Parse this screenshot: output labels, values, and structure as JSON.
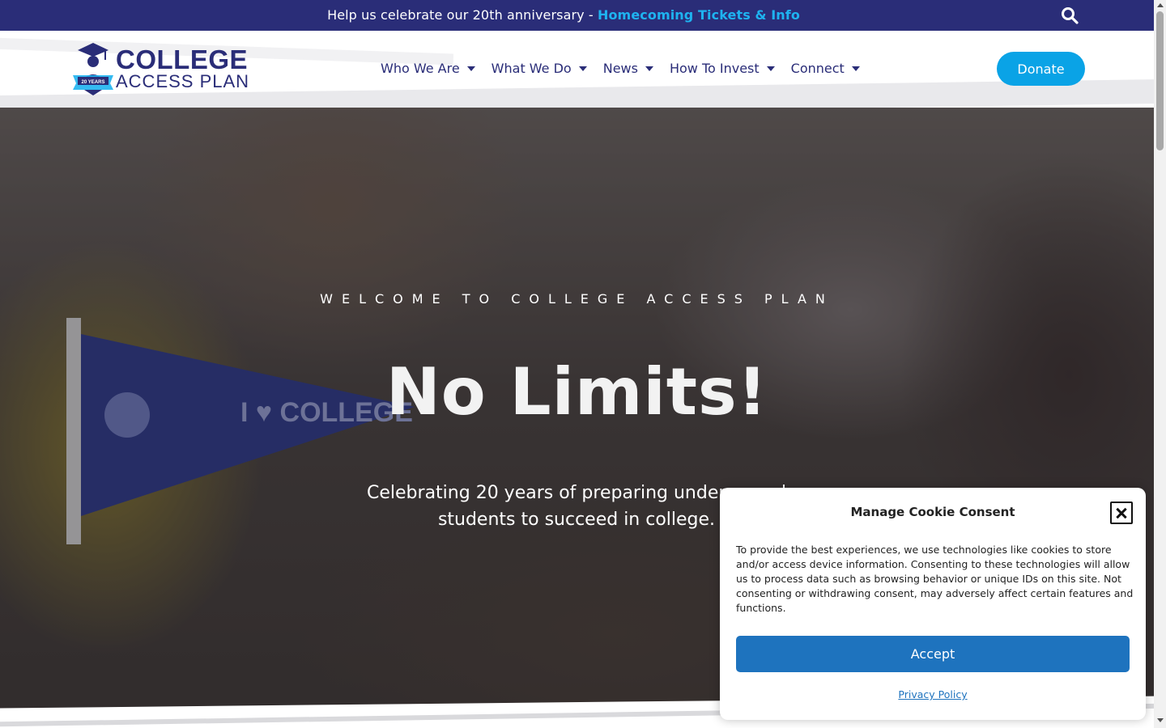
{
  "topbar": {
    "message": "Help us celebrate our 20th anniversary - ",
    "link_label": "Homecoming Tickets & Info",
    "search_icon": "search-icon"
  },
  "header": {
    "logo": {
      "line1": "COLLEGE",
      "line2": "ACCESS PLAN",
      "badge": "20 YEARS"
    },
    "nav": [
      {
        "label": "Who We Are"
      },
      {
        "label": "What We Do"
      },
      {
        "label": "News"
      },
      {
        "label": "How To Invest"
      },
      {
        "label": "Connect"
      }
    ],
    "donate_label": "Donate"
  },
  "hero": {
    "eyebrow": "WELCOME TO COLLEGE ACCESS PLAN",
    "title": "No Limits!",
    "subtitle": "Celebrating 20 years of preparing underserved students to succeed in college.",
    "pennant_text": "I ♥ COLLEGE"
  },
  "cookie": {
    "title": "Manage Cookie Consent",
    "body": "To provide the best experiences, we use technologies like cookies to store and/or access device information. Consenting to these technologies will allow us to process data such as browsing behavior or unique IDs on this site. Not consenting or withdrawing consent, may adversely affect certain features and functions.",
    "accept_label": "Accept",
    "privacy_label": "Privacy Policy"
  },
  "colors": {
    "brand_navy": "#2a2d78",
    "accent_blue": "#0aa3e6",
    "link_blue": "#1eb3f0",
    "cookie_button": "#1e73be"
  }
}
